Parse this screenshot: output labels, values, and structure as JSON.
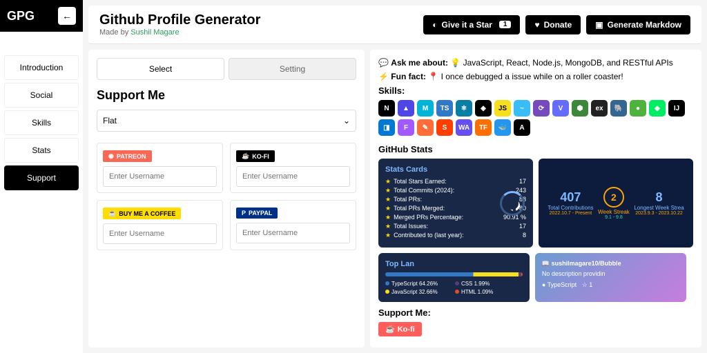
{
  "brand": "GPG",
  "header": {
    "title": "Github Profile Generator",
    "made_by_prefix": "Made by ",
    "made_by_author": "Sushil Magare",
    "star_label": "Give it a Star",
    "star_count": "1",
    "donate_label": "Donate",
    "generate_label": "Generate Markdow"
  },
  "sidebar": {
    "items": [
      {
        "label": "Introduction"
      },
      {
        "label": "Social"
      },
      {
        "label": "Skills"
      },
      {
        "label": "Stats"
      },
      {
        "label": "Support"
      }
    ]
  },
  "form": {
    "tabs": {
      "select": "Select",
      "setting": "Setting"
    },
    "section_title": "Support Me",
    "style_select": "Flat",
    "cards": {
      "patreon": {
        "badge": "PATREON",
        "placeholder": "Enter Username"
      },
      "kofi": {
        "badge": "KO-FI",
        "placeholder": "Enter Username"
      },
      "bmc": {
        "badge": "BUY ME A COFFEE",
        "placeholder": "Enter Username"
      },
      "paypal": {
        "badge": "PAYPAL",
        "placeholder": "Enter Username"
      }
    }
  },
  "preview": {
    "lines": {
      "ask_label": "Ask me about:",
      "ask_text": "JavaScript, React, Node.js, MongoDB, and RESTful APIs",
      "fun_label": "Fun fact:",
      "fun_text": "I once debugged a issue while on a roller coaster!"
    },
    "skills_title": "Skills:",
    "skills": [
      {
        "bg": "#000",
        "t": "N"
      },
      {
        "bg": "#4f46e5",
        "t": "▲"
      },
      {
        "bg": "#00b4d8",
        "t": "M"
      },
      {
        "bg": "#3178c6",
        "t": "TS"
      },
      {
        "bg": "#087ea4",
        "t": "⚛"
      },
      {
        "bg": "#000",
        "t": "◈"
      },
      {
        "bg": "#f7df1e",
        "t": "JS",
        "c": "#000"
      },
      {
        "bg": "#38bdf8",
        "t": "~"
      },
      {
        "bg": "#764abc",
        "t": "⟳"
      },
      {
        "bg": "#646cff",
        "t": "V"
      },
      {
        "bg": "#3c873a",
        "t": "⬢"
      },
      {
        "bg": "#222",
        "t": "ex"
      },
      {
        "bg": "#336791",
        "t": "🐘"
      },
      {
        "bg": "#4db33d",
        "t": "●"
      },
      {
        "bg": "#00ed64",
        "t": "◆"
      },
      {
        "bg": "#000",
        "t": "IJ"
      },
      {
        "bg": "#0078d4",
        "t": "◨"
      },
      {
        "bg": "#a259ff",
        "t": "F"
      },
      {
        "bg": "#ff6c37",
        "t": "✎"
      },
      {
        "bg": "#ff3e00",
        "t": "S"
      },
      {
        "bg": "#654ff0",
        "t": "WA"
      },
      {
        "bg": "#ff6f00",
        "t": "TF"
      },
      {
        "bg": "#2496ed",
        "t": "🐳"
      },
      {
        "bg": "#000",
        "t": "A"
      }
    ],
    "github_stats_title": "GitHub Stats",
    "stats_card": {
      "title": "Stats Cards",
      "rows": [
        {
          "label": "Total Stars Earned:",
          "val": "17"
        },
        {
          "label": "Total Commits (2024):",
          "val": "243"
        },
        {
          "label": "Total PRs:",
          "val": "88"
        },
        {
          "label": "Total PRs Merged:",
          "val": "80"
        },
        {
          "label": "Merged PRs Percentage:",
          "val": "90.91 %"
        },
        {
          "label": "Total Issues:",
          "val": "17"
        },
        {
          "label": "Contributed to (last year):",
          "val": "8"
        }
      ]
    },
    "streak": {
      "contrib_num": "407",
      "contrib_label": "Total Contributions",
      "contrib_date": "2022.10.7 - Present",
      "streak_num": "2",
      "streak_label": "Week Streak",
      "streak_date": "9.1 - 9.8",
      "longest_num": "8",
      "longest_label": "Longest Week Strea",
      "longest_date": "2023.9.3 - 2023.10.22"
    },
    "lang": {
      "title": "Top Lan",
      "items": [
        {
          "name": "TypeScript 64.26%",
          "color": "#3178c6"
        },
        {
          "name": "CSS 1.99%",
          "color": "#563d7c"
        },
        {
          "name": "JavaScript 32.66%",
          "color": "#f7df1e"
        },
        {
          "name": "HTML 1.09%",
          "color": "#e34c26"
        }
      ]
    },
    "repo": {
      "name": "sushilmagare10/Bubble",
      "desc": "No description providin",
      "lang": "TypeScript",
      "stars": "1"
    },
    "support_title": "Support Me:",
    "kofi_label": "Ko-fi"
  }
}
